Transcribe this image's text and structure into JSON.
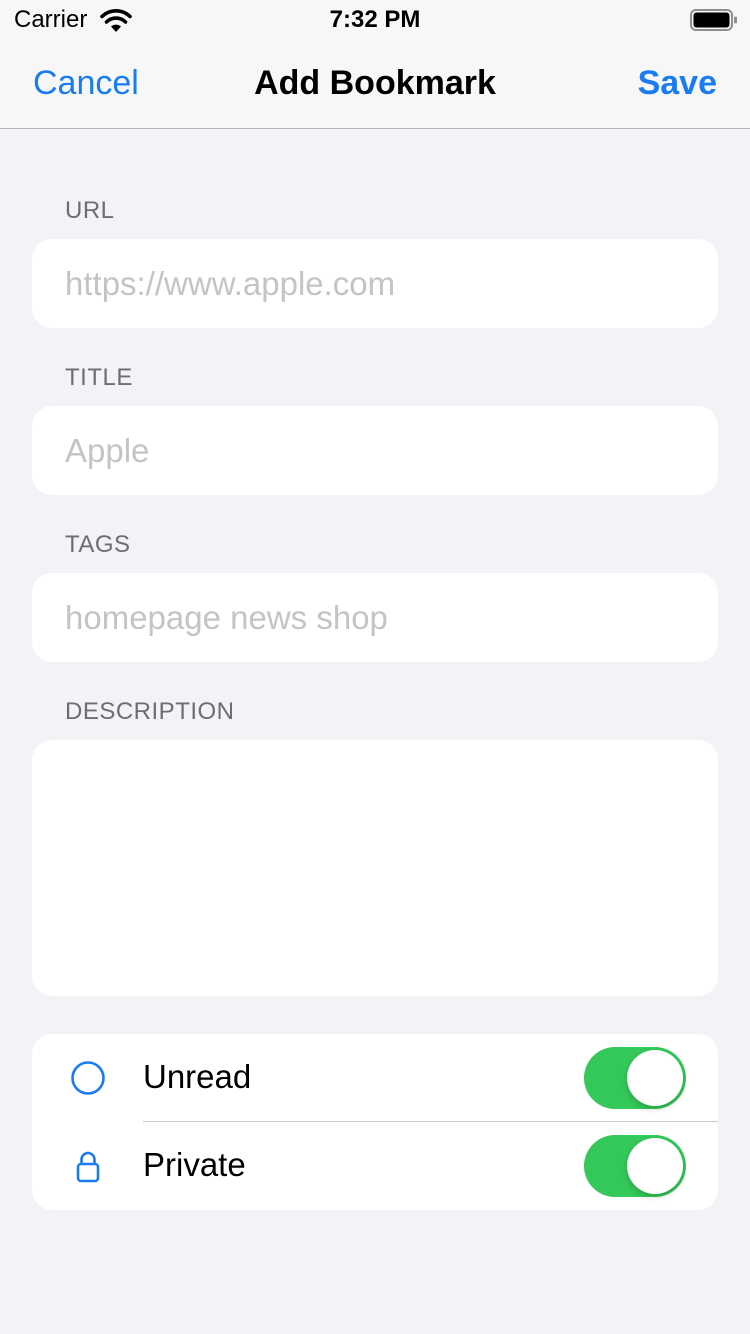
{
  "status_bar": {
    "carrier": "Carrier",
    "time": "7:32 PM"
  },
  "nav": {
    "cancel_label": "Cancel",
    "title": "Add Bookmark",
    "save_label": "Save"
  },
  "form": {
    "url": {
      "label": "URL",
      "value": "",
      "placeholder": "https://www.apple.com"
    },
    "title": {
      "label": "TITLE",
      "value": "",
      "placeholder": "Apple"
    },
    "tags": {
      "label": "TAGS",
      "value": "",
      "placeholder": "homepage news shop"
    },
    "description": {
      "label": "DESCRIPTION",
      "value": ""
    }
  },
  "toggles": [
    {
      "label": "Unread",
      "icon": "circle-icon",
      "on": true
    },
    {
      "label": "Private",
      "icon": "lock-icon",
      "on": true
    }
  ],
  "colors": {
    "accent": "#1a7cf1",
    "switch_on": "#34c759",
    "background": "#f2f2f7"
  }
}
